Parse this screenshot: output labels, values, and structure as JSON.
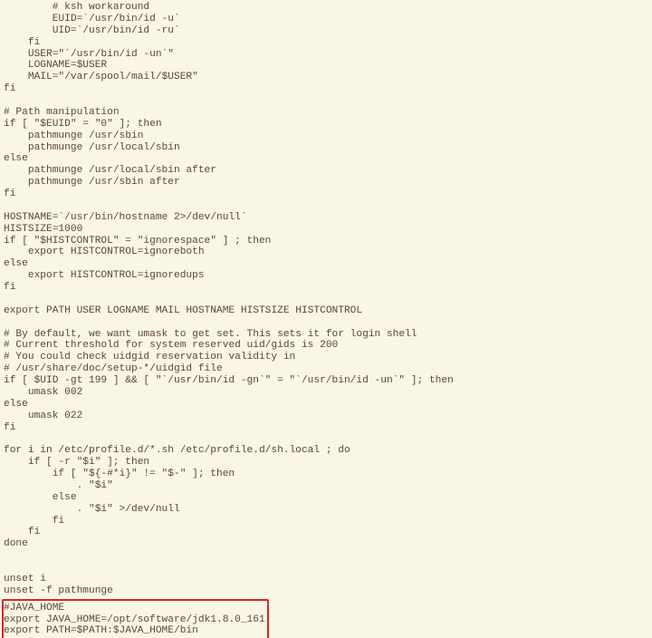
{
  "code": {
    "main": "        # ksh workaround\n        EUID=`/usr/bin/id -u`\n        UID=`/usr/bin/id -ru`\n    fi\n    USER=\"`/usr/bin/id -un`\"\n    LOGNAME=$USER\n    MAIL=\"/var/spool/mail/$USER\"\nfi\n\n# Path manipulation\nif [ \"$EUID\" = \"0\" ]; then\n    pathmunge /usr/sbin\n    pathmunge /usr/local/sbin\nelse\n    pathmunge /usr/local/sbin after\n    pathmunge /usr/sbin after\nfi\n\nHOSTNAME=`/usr/bin/hostname 2>/dev/null`\nHISTSIZE=1000\nif [ \"$HISTCONTROL\" = \"ignorespace\" ] ; then\n    export HISTCONTROL=ignoreboth\nelse\n    export HISTCONTROL=ignoredups\nfi\n\nexport PATH USER LOGNAME MAIL HOSTNAME HISTSIZE HISTCONTROL\n\n# By default, we want umask to get set. This sets it for login shell\n# Current threshold for system reserved uid/gids is 200\n# You could check uidgid reservation validity in\n# /usr/share/doc/setup-*/uidgid file\nif [ $UID -gt 199 ] && [ \"`/usr/bin/id -gn`\" = \"`/usr/bin/id -un`\" ]; then\n    umask 002\nelse\n    umask 022\nfi\n\nfor i in /etc/profile.d/*.sh /etc/profile.d/sh.local ; do\n    if [ -r \"$i\" ]; then\n        if [ \"${-#*i}\" != \"$-\" ]; then\n            . \"$i\"\n        else\n            . \"$i\" >/dev/null\n        fi\n    fi\ndone\n\n\nunset i\nunset -f pathmunge\n",
    "highlight": "#JAVA_HOME\nexport JAVA_HOME=/opt/software/jdk1.8.0_161\nexport PATH=$PATH:$JAVA_HOME/bin"
  }
}
